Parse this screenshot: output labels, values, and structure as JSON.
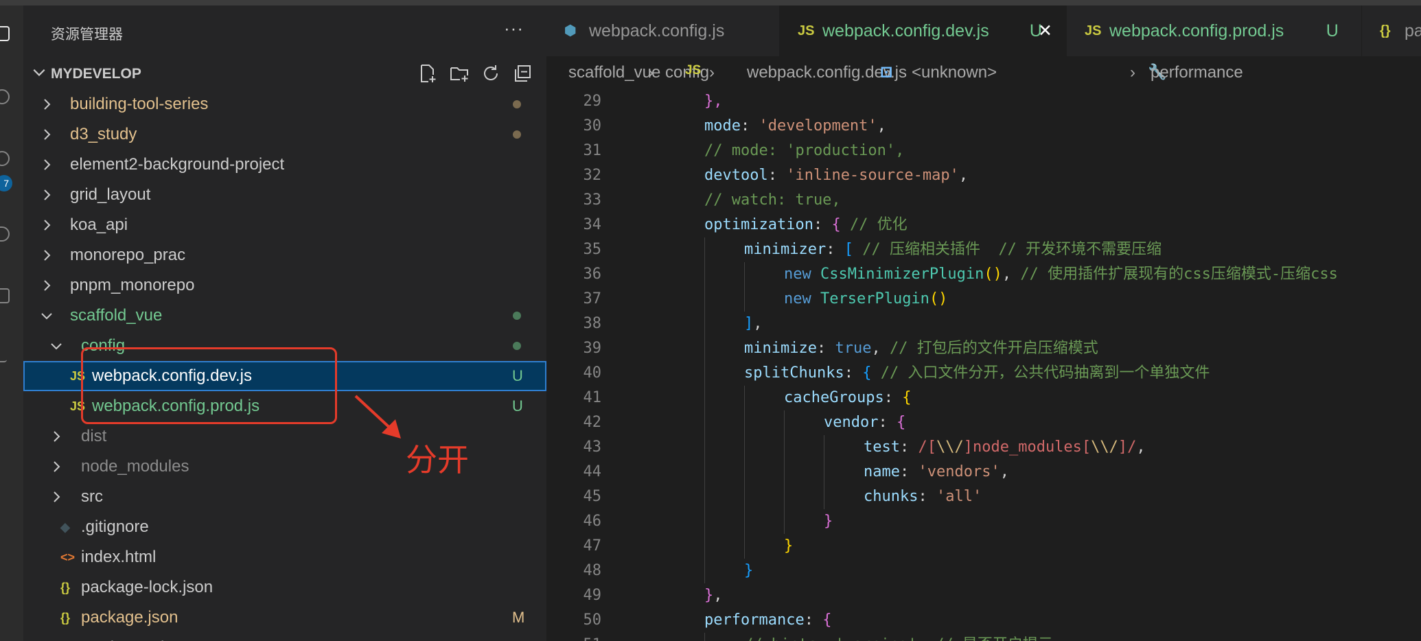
{
  "sidebar": {
    "title": "资源管理器",
    "more_label": "···",
    "workspace": "MYDEVELOP",
    "items": [
      {
        "label": "building-tool-series",
        "color": "#e2c08d",
        "chevron": "right",
        "indent": 0,
        "dot": "#7a6a4f"
      },
      {
        "label": "d3_study",
        "color": "#e2c08d",
        "chevron": "right",
        "indent": 0,
        "dot": "#7a6a4f"
      },
      {
        "label": "element2-background-project",
        "color": "#cccccc",
        "chevron": "right",
        "indent": 0
      },
      {
        "label": "grid_layout",
        "color": "#cccccc",
        "chevron": "right",
        "indent": 0
      },
      {
        "label": "koa_api",
        "color": "#cccccc",
        "chevron": "right",
        "indent": 0
      },
      {
        "label": "monorepo_prac",
        "color": "#cccccc",
        "chevron": "right",
        "indent": 0
      },
      {
        "label": "pnpm_monorepo",
        "color": "#cccccc",
        "chevron": "right",
        "indent": 0
      },
      {
        "label": "scaffold_vue",
        "color": "#73c991",
        "chevron": "down",
        "indent": 0,
        "dot": "#4b7a5a"
      },
      {
        "label": "config",
        "color": "#73c991",
        "chevron": "down",
        "indent": 1,
        "dot": "#4b7a5a"
      },
      {
        "label": "webpack.config.dev.js",
        "color": "#ffffff",
        "icon": "JS",
        "icon_color": "#cbcb41",
        "indent": 2,
        "badge": "U",
        "badge_color": "#73c991",
        "selected": true
      },
      {
        "label": "webpack.config.prod.js",
        "color": "#73c991",
        "icon": "JS",
        "icon_color": "#cbcb41",
        "indent": 2,
        "badge": "U",
        "badge_color": "#73c991"
      },
      {
        "label": "dist",
        "color": "#8c8c8c",
        "chevron": "right",
        "indent": 1
      },
      {
        "label": "node_modules",
        "color": "#8c8c8c",
        "chevron": "right",
        "indent": 1
      },
      {
        "label": "src",
        "color": "#cccccc",
        "chevron": "right",
        "indent": 1
      },
      {
        "label": ".gitignore",
        "color": "#cccccc",
        "icon": "◆",
        "icon_color": "#41535b",
        "indent": 1
      },
      {
        "label": "index.html",
        "color": "#cccccc",
        "icon": "<>",
        "icon_color": "#e37933",
        "indent": 1
      },
      {
        "label": "package-lock.json",
        "color": "#cccccc",
        "icon": "{}",
        "icon_color": "#cbcb41",
        "indent": 1
      },
      {
        "label": "package.json",
        "color": "#e2c08d",
        "icon": "{}",
        "icon_color": "#cbcb41",
        "indent": 1,
        "badge": "M",
        "badge_color": "#e2c08d"
      },
      {
        "label": "readme.md",
        "color": "#cccccc",
        "icon": "ⓘ",
        "icon_color": "#519aba",
        "indent": 1
      }
    ]
  },
  "annotation": {
    "label": "分开",
    "color": "#e53b2a"
  },
  "tabs": [
    {
      "label": "webpack.config.js",
      "icon": "⬢",
      "icon_color": "#519aba",
      "color": "#969696",
      "active": false
    },
    {
      "label": "webpack.config.dev.js",
      "suffix": "U",
      "icon": "JS",
      "icon_color": "#cbcb41",
      "color": "#73c991",
      "active": true,
      "close": "✕"
    },
    {
      "label": "webpack.config.prod.js",
      "suffix": "U",
      "icon": "JS",
      "icon_color": "#cbcb41",
      "color": "#73c991",
      "active": false
    },
    {
      "label": "pa",
      "icon": "{}",
      "icon_color": "#cbcb41",
      "color": "#969696",
      "active": false
    }
  ],
  "breadcrumb": {
    "items": [
      "scaffold_vue",
      "config",
      "webpack.config.dev.js",
      "<unknown>",
      "performance"
    ],
    "separator": "›",
    "icons": [
      "",
      "",
      "JS",
      "⊡",
      "🔧"
    ]
  },
  "code": {
    "lines": [
      {
        "n": "29",
        "indent": 1,
        "tokens": [
          [
            "b2",
            "},"
          ]
        ]
      },
      {
        "n": "30",
        "indent": 1,
        "tokens": [
          [
            "prop",
            "mode"
          ],
          [
            "pun",
            ": "
          ],
          [
            "str",
            "'development'"
          ],
          [
            "pun",
            ","
          ]
        ]
      },
      {
        "n": "31",
        "indent": 1,
        "tokens": [
          [
            "com",
            "// mode: 'production',"
          ]
        ]
      },
      {
        "n": "32",
        "indent": 1,
        "tokens": [
          [
            "prop",
            "devtool"
          ],
          [
            "pun",
            ": "
          ],
          [
            "str",
            "'inline-source-map'"
          ],
          [
            "pun",
            ","
          ]
        ]
      },
      {
        "n": "33",
        "indent": 1,
        "tokens": [
          [
            "com",
            "// watch: true,"
          ]
        ]
      },
      {
        "n": "34",
        "indent": 1,
        "tokens": [
          [
            "prop",
            "optimization"
          ],
          [
            "pun",
            ": "
          ],
          [
            "b2",
            "{"
          ],
          [
            "com",
            " // 优化"
          ]
        ]
      },
      {
        "n": "35",
        "indent": 2,
        "tokens": [
          [
            "prop",
            "minimizer"
          ],
          [
            "pun",
            ": "
          ],
          [
            "b3",
            "["
          ],
          [
            "com",
            " // 压缩相关插件  // 开发环境不需要压缩"
          ]
        ]
      },
      {
        "n": "36",
        "indent": 3,
        "tokens": [
          [
            "kw",
            "new "
          ],
          [
            "cls",
            "CssMinimizerPlugin"
          ],
          [
            "b1",
            "()"
          ],
          [
            "pun",
            ", "
          ],
          [
            "com",
            "// 使用插件扩展现有的css压缩模式-压缩css"
          ]
        ]
      },
      {
        "n": "37",
        "indent": 3,
        "tokens": [
          [
            "kw",
            "new "
          ],
          [
            "cls",
            "TerserPlugin"
          ],
          [
            "b1",
            "()"
          ]
        ]
      },
      {
        "n": "38",
        "indent": 2,
        "tokens": [
          [
            "b3",
            "]"
          ],
          [
            "pun",
            ","
          ]
        ]
      },
      {
        "n": "39",
        "indent": 2,
        "tokens": [
          [
            "prop",
            "minimize"
          ],
          [
            "pun",
            ": "
          ],
          [
            "kw",
            "true"
          ],
          [
            "pun",
            ", "
          ],
          [
            "com",
            "// 打包后的文件开启压缩模式"
          ]
        ]
      },
      {
        "n": "40",
        "indent": 2,
        "tokens": [
          [
            "prop",
            "splitChunks"
          ],
          [
            "pun",
            ": "
          ],
          [
            "b3",
            "{"
          ],
          [
            "com",
            " // 入口文件分开，公共代码抽离到一个单独文件"
          ]
        ]
      },
      {
        "n": "41",
        "indent": 3,
        "tokens": [
          [
            "prop",
            "cacheGroups"
          ],
          [
            "pun",
            ": "
          ],
          [
            "b1",
            "{"
          ]
        ]
      },
      {
        "n": "42",
        "indent": 4,
        "tokens": [
          [
            "prop",
            "vendor"
          ],
          [
            "pun",
            ": "
          ],
          [
            "b2",
            "{"
          ]
        ]
      },
      {
        "n": "43",
        "indent": 5,
        "tokens": [
          [
            "prop",
            "test"
          ],
          [
            "pun",
            ": "
          ],
          [
            "re",
            "/["
          ],
          [
            "esc",
            "\\\\/"
          ],
          [
            "re",
            "]node_modules["
          ],
          [
            "esc",
            "\\\\/"
          ],
          [
            "re",
            "]/"
          ],
          [
            "pun",
            ","
          ]
        ]
      },
      {
        "n": "44",
        "indent": 5,
        "tokens": [
          [
            "prop",
            "name"
          ],
          [
            "pun",
            ": "
          ],
          [
            "str",
            "'vendors'"
          ],
          [
            "pun",
            ","
          ]
        ]
      },
      {
        "n": "45",
        "indent": 5,
        "tokens": [
          [
            "prop",
            "chunks"
          ],
          [
            "pun",
            ": "
          ],
          [
            "str",
            "'all'"
          ]
        ]
      },
      {
        "n": "46",
        "indent": 4,
        "tokens": [
          [
            "b2",
            "}"
          ]
        ]
      },
      {
        "n": "47",
        "indent": 3,
        "tokens": [
          [
            "b1",
            "}"
          ]
        ]
      },
      {
        "n": "48",
        "indent": 2,
        "tokens": [
          [
            "b3",
            "}"
          ]
        ]
      },
      {
        "n": "49",
        "indent": 1,
        "tokens": [
          [
            "b2",
            "}"
          ],
          [
            "pun",
            ","
          ]
        ]
      },
      {
        "n": "50",
        "indent": 1,
        "tokens": [
          [
            "prop",
            "performance"
          ],
          [
            "pun",
            ": "
          ],
          [
            "b2",
            "{"
          ]
        ]
      },
      {
        "n": "51",
        "indent": 2,
        "tokens": [
          [
            "com",
            "// hints: 'warning', // 是否开启提示"
          ]
        ]
      }
    ]
  },
  "activity_badge": "7"
}
